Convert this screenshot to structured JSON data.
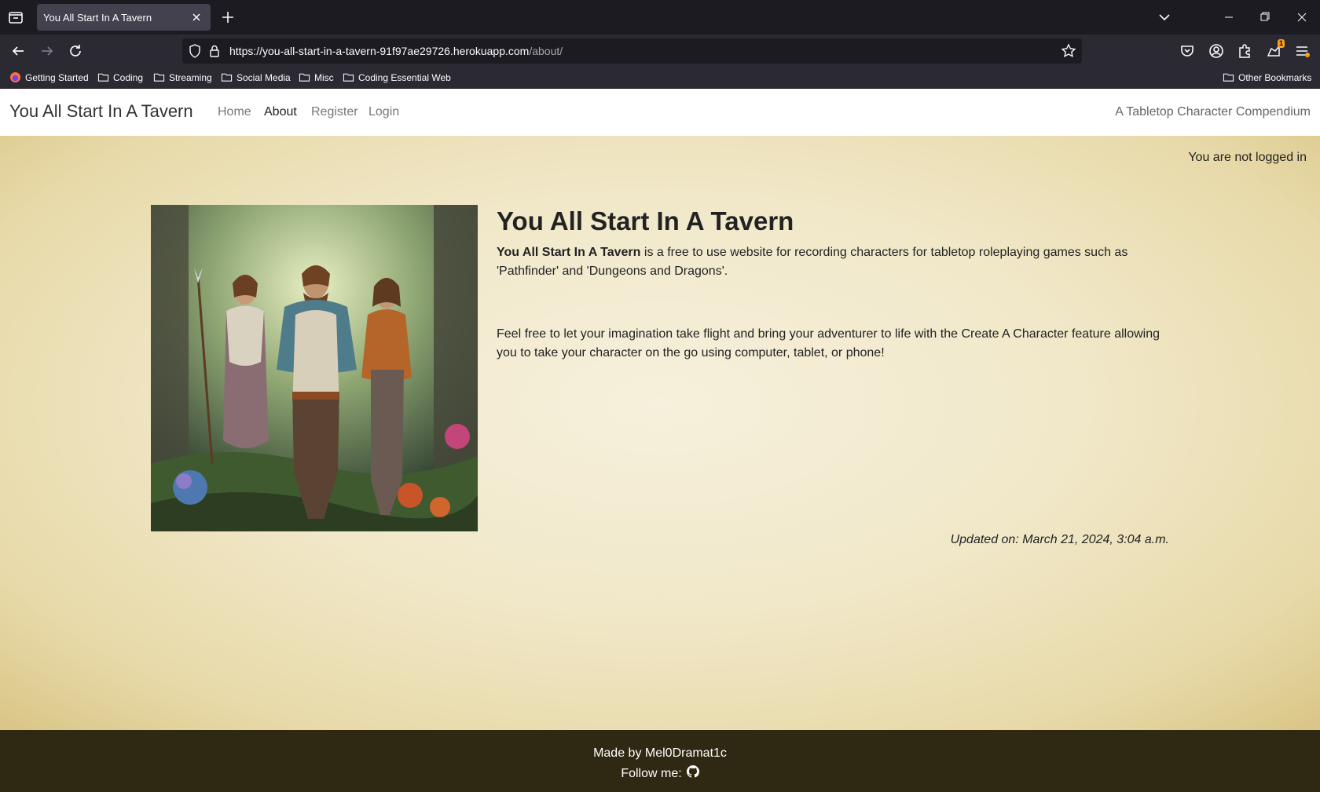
{
  "browser": {
    "tab_title": "You All Start In A Tavern",
    "url_main": "https://you-all-start-in-a-tavern-91f97ae29726.herokuapp.com",
    "url_path": "/about/",
    "notification_count": "1",
    "bookmarks": [
      "Getting Started",
      "Coding",
      "Streaming",
      "Social Media",
      "Misc",
      "Coding Essential Web"
    ],
    "other_bookmarks": "Other Bookmarks"
  },
  "site": {
    "brand": "You All Start In A Tavern",
    "nav": [
      "Home",
      "About",
      "Register",
      "Login"
    ],
    "tagline": "A Tabletop Character Compendium",
    "login_status": "You are not logged in"
  },
  "content": {
    "title": "You All Start In A Tavern",
    "para1_bold": "You All Start In A Tavern",
    "para1_rest": " is a free to use website for recording characters for tabletop roleplaying games such as 'Pathfinder' and 'Dungeons and Dragons'.",
    "para2": "Feel free to let your imagination take flight and bring your adventurer to life with the Create A Character feature allowing you to take your character on the go using computer, tablet, or phone!",
    "updated": "Updated on: March 21, 2024, 3:04 a.m."
  },
  "footer": {
    "made_by": "Made by Mel0Dramat1c",
    "follow": "Follow me:"
  },
  "colors": {
    "footer_bg": "#2f2812",
    "chrome_bg": "#1c1b22",
    "toolbar_bg": "#2b2a33"
  },
  "icons": [
    "github-icon",
    "folder-icon",
    "firefox-icon"
  ]
}
